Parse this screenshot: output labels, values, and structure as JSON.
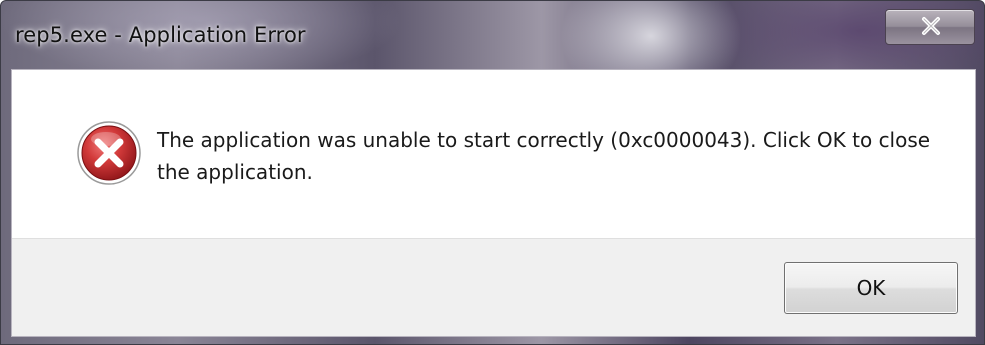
{
  "window": {
    "title": "rep5.exe - Application Error"
  },
  "dialog": {
    "icon": "error-icon",
    "message": "The application was unable to start correctly (0xc0000043). Click OK to close the application.",
    "ok_label": "OK"
  },
  "titlebar": {
    "close_icon": "close-icon"
  },
  "colors": {
    "error_red": "#c0272d",
    "button_face": "#e6e6e6",
    "button_area": "#f0f0f0"
  }
}
